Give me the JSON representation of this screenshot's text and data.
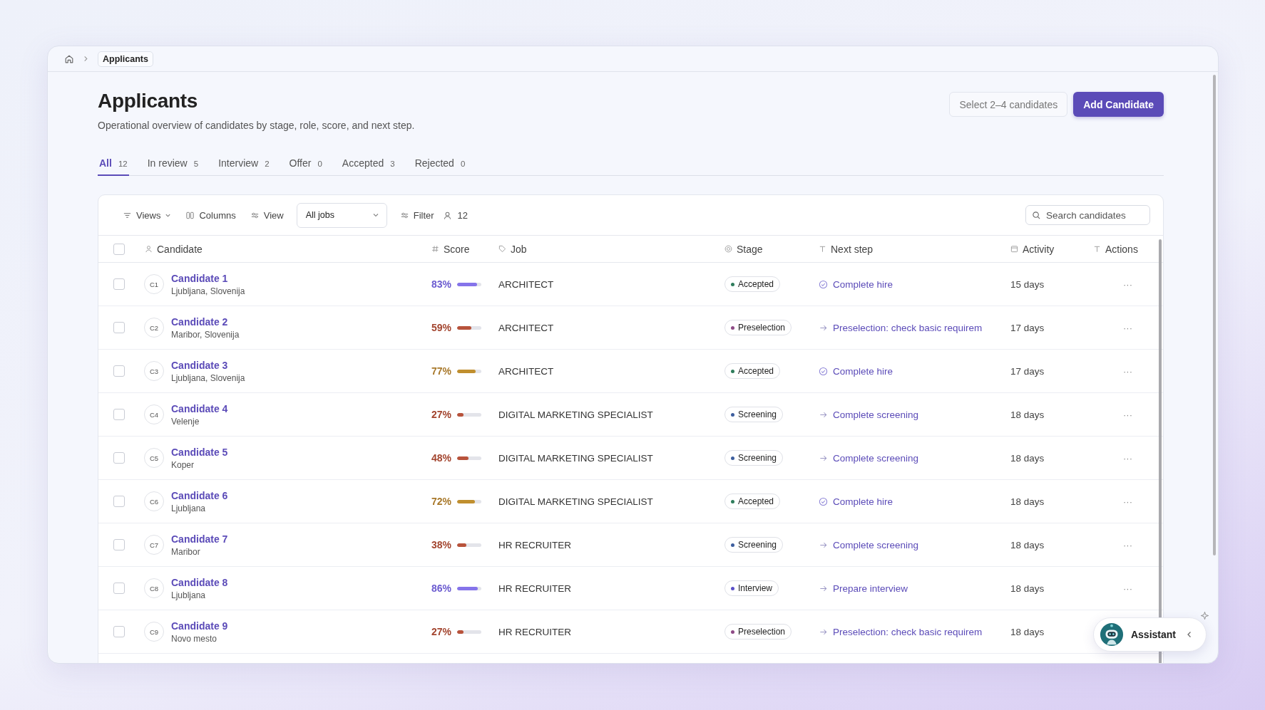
{
  "breadcrumb": {
    "current": "Applicants"
  },
  "header": {
    "title": "Applicants",
    "subtitle": "Operational overview of candidates by stage, role, score, and next step.",
    "compare_button": "Select 2–4 candidates",
    "add_button": "Add Candidate"
  },
  "tabs": [
    {
      "label": "All",
      "count": "12",
      "selected": true
    },
    {
      "label": "In review",
      "count": "5",
      "selected": false
    },
    {
      "label": "Interview",
      "count": "2",
      "selected": false
    },
    {
      "label": "Offer",
      "count": "0",
      "selected": false
    },
    {
      "label": "Accepted",
      "count": "3",
      "selected": false
    },
    {
      "label": "Rejected",
      "count": "0",
      "selected": false
    }
  ],
  "toolbar": {
    "views": "Views",
    "columns": "Columns",
    "view": "View",
    "job_select": "All jobs",
    "filter": "Filter",
    "count": "12",
    "search": {
      "placeholder": "Search candidates"
    }
  },
  "table": {
    "select_all": {
      "checked": false
    },
    "columns": [
      "Candidate",
      "Score",
      "Job",
      "Stage",
      "Next step",
      "Activity",
      "Actions"
    ],
    "rows": [
      {
        "checked": false,
        "initials": "C1",
        "name": "Candidate 1",
        "location": "Ljubljana, Slovenija",
        "score": "83%",
        "level": 0.83,
        "job": "ARCHITECT",
        "stage": {
          "label": "Accepted",
          "color": "#2f7d5c"
        },
        "next": {
          "kind": "done",
          "text": "Complete hire"
        },
        "activity": "15 days",
        "actions": "···"
      },
      {
        "checked": false,
        "initials": "C2",
        "name": "Candidate 2",
        "location": "Maribor, Slovenija",
        "score": "59%",
        "level": 0.59,
        "job": "ARCHITECT",
        "stage": {
          "label": "Preselection",
          "color": "#8e4a86"
        },
        "next": {
          "kind": "step",
          "text": "Preselection: check basic requirem"
        },
        "activity": "17 days",
        "actions": "···"
      },
      {
        "checked": false,
        "initials": "C3",
        "name": "Candidate 3",
        "location": "Ljubljana, Slovenija",
        "score": "77%",
        "level": 0.77,
        "job": "ARCHITECT",
        "stage": {
          "label": "Accepted",
          "color": "#2f7d5c"
        },
        "next": {
          "kind": "done",
          "text": "Complete hire"
        },
        "activity": "17 days",
        "actions": "···"
      },
      {
        "checked": false,
        "initials": "C4",
        "name": "Candidate 4",
        "location": "Velenje",
        "score": "27%",
        "level": 0.27,
        "job": "DIGITAL MARKETING SPECIALIST",
        "stage": {
          "label": "Screening",
          "color": "#3d5e9e"
        },
        "next": {
          "kind": "step",
          "text": "Complete screening"
        },
        "activity": "18 days",
        "actions": "···"
      },
      {
        "checked": false,
        "initials": "C5",
        "name": "Candidate 5",
        "location": "Koper",
        "score": "48%",
        "level": 0.48,
        "job": "DIGITAL MARKETING SPECIALIST",
        "stage": {
          "label": "Screening",
          "color": "#3d5e9e"
        },
        "next": {
          "kind": "step",
          "text": "Complete screening"
        },
        "activity": "18 days",
        "actions": "···"
      },
      {
        "checked": false,
        "initials": "C6",
        "name": "Candidate 6",
        "location": "Ljubljana",
        "score": "72%",
        "level": 0.72,
        "job": "DIGITAL MARKETING SPECIALIST",
        "stage": {
          "label": "Accepted",
          "color": "#2f7d5c"
        },
        "next": {
          "kind": "done",
          "text": "Complete hire"
        },
        "activity": "18 days",
        "actions": "···"
      },
      {
        "checked": false,
        "initials": "C7",
        "name": "Candidate 7",
        "location": "Maribor",
        "score": "38%",
        "level": 0.38,
        "job": "HR RECRUITER",
        "stage": {
          "label": "Screening",
          "color": "#3d5e9e"
        },
        "next": {
          "kind": "step",
          "text": "Complete screening"
        },
        "activity": "18 days",
        "actions": "···"
      },
      {
        "checked": false,
        "initials": "C8",
        "name": "Candidate 8",
        "location": "Ljubljana",
        "score": "86%",
        "level": 0.86,
        "job": "HR RECRUITER",
        "stage": {
          "label": "Interview",
          "color": "#5a4fc8"
        },
        "next": {
          "kind": "step",
          "text": "Prepare interview"
        },
        "activity": "18 days",
        "actions": "···"
      },
      {
        "checked": false,
        "initials": "C9",
        "name": "Candidate 9",
        "location": "Novo mesto",
        "score": "27%",
        "level": 0.27,
        "job": "HR RECRUITER",
        "stage": {
          "label": "Preselection",
          "color": "#8e4a86"
        },
        "next": {
          "kind": "step",
          "text": "Preselection: check basic requirem"
        },
        "activity": "18 days"
      }
    ]
  },
  "assistant": {
    "label": "Assistant"
  }
}
